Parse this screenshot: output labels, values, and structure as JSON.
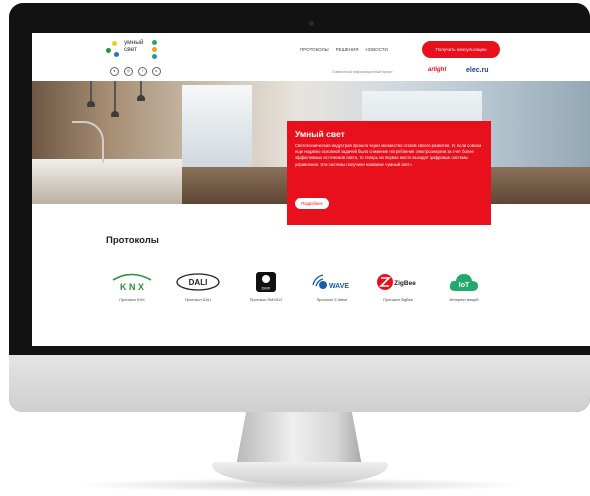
{
  "site": {
    "logo_line1": "умный",
    "logo_line2": "свет",
    "logo_colors": [
      "#f6c915",
      "#2f8f3a",
      "#1d78c8",
      "#2aa86b",
      "#f0a21a",
      "#1f9a96"
    ]
  },
  "nav": {
    "items": [
      "ПРОТОКОЛЫ",
      "РЕШЕНИЯ",
      "НОВОСТИ"
    ],
    "cta_label": "Получить консультацию"
  },
  "social": [
    "vk",
    "ig",
    "fb",
    "yt"
  ],
  "partners": {
    "label": "Совместный информационный проект:",
    "brand1": "arlight",
    "brand2": "elec.ru"
  },
  "hero": {
    "title": "Умный свет",
    "text": "Светотехническая индустрия прошла через множество этапов своего развития. И, если совсем еще недавно основной задачей было снижение потребления электроэнергии за счет более эффективных источников света, то теперь на первое место выходят цифровые системы управления. Эти системы получили название «умный свет».",
    "button_label": "Подробнее"
  },
  "protocols": {
    "title": "Протоколы",
    "items": [
      {
        "label": "Протокол KNX",
        "icon": "knx-logo"
      },
      {
        "label": "Протокол DALI",
        "icon": "dali-logo"
      },
      {
        "label": "Протокол DMX512",
        "icon": "dmx-logo"
      },
      {
        "label": "Протокол Z-Wave",
        "icon": "zwave-logo"
      },
      {
        "label": "Протокол ZigBee",
        "icon": "zigbee-logo"
      },
      {
        "label": "Интернет вещей",
        "icon": "iot-cloud-logo"
      }
    ],
    "logo_texts": {
      "knx": "K N X",
      "dali": "DALI",
      "dmx": "DMX",
      "zwave": "WAVE",
      "zigbee": "ZigBee",
      "iot": "IoT"
    }
  },
  "colors": {
    "accent": "#e8101c",
    "knx_green": "#2f8f3a",
    "zwave_blue": "#1a5da8",
    "iot_green": "#22a96b"
  }
}
